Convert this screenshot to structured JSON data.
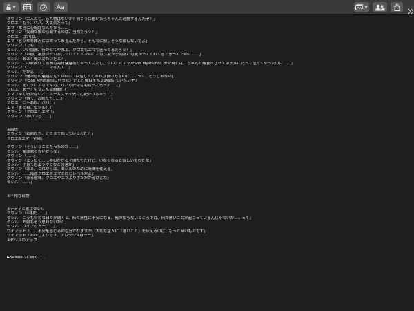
{
  "toolbar": {
    "left_icons": [
      "lock-icon",
      "sidebar-grid-icon",
      "checkmark-circle-icon"
    ],
    "format_label": "Aa",
    "right_icons": [
      "photo-gallery-icon",
      "collaborate-icon",
      "share-icon",
      "expand-icon"
    ]
  },
  "lines": [
    "ケヴィン「二人とも、忘れ物はないか？向こうに着いたらちゃんと連絡するんだぞ？」",
    "クロエ「もう、パパ。大丈夫だって」",
    "エマ「本当に心配症なんだから……」",
    "ケヴィン「父親が娘の心配するのは、当然だろう？」",
    "クロエ「はいはい」",
    "エマ「どうせ冬休みには帰って来るんだから、そんなに寂しそうな顔しないでよ」",
    "ケヴィン「でも……」",
    "セシル「いい加減、行かせてやれよ。クロエもエマも困ってるだろう？」",
    "ケヴィン「お前、案外冷たいな。クロエとエマのことは、我が子同然に可愛がってくれてると思ってたのに……」",
    "セシル「あぁ？俺が冷たいだと？」",
    "セシル「この家安けてる間も毎日連絡取り合っていたし、クロエとエマがSon Myshunoに来た時には、ちゃんと飯食べさせてホテルにだって送ってやったのに……」",
    "ケヴィン「………………今なんて？」",
    "セシル「だから……」",
    "ケヴィン「俺からの連絡なんて10回に1回返してくれれば良い方なのに……って、そうじゃない」",
    "ケヴィン「『Son Myshunoに行った』だと？俺はそんな話聞いていないぞ」",
    "セシル「え？クロエもエマも、パパの許可はもらってるって……」",
    "クロエ「あー！もうこんな時間!!」",
    "エマ「早く行かないと、ホームステイ先に心配かけちゃう！」",
    "ケヴィン「待て、お前たち……」",
    "クロエ「じゃあね、パパ！」",
    "エマ「またね、セシル！」",
    "ケヴィン「クロエ！エマ!!」",
    "ケヴィン「あいつら……」",
    "",
    "",
    "※回想",
    "ケヴィン「お前たち、どこまで知っているんだ？」",
    "クロエ&エマ「全部」",
    "",
    "ケヴィン「そういうことだったのか……」",
    "セシル「俺は悪くないからな」",
    "ケヴィン「……」",
    "ケヴィン「まったく……手のかかる子供たちだけど、いなくなると寂しいものだな」",
    "セシル「子育てもようやくひと段落か」",
    "ケヴィン「あぁ。これからは、セシルのために時間を使える」",
    "セシル「……俺はクロエやエマと同じレベルかよ」",
    "ケヴィン「ある意味、クロエやエマより手がかかるけどな」",
    "セシル「……」",
    "",
    "",
    "※平和な日常",
    "",
    "",
    "※デディと遊ぶセシル",
    "ケヴィン「平和だ……」",
    "セシル「こうも平和な日々が続くと、時々無性に不安になる。俺の知らないところでは、何か悪いことが起こっているんじゃないか……って」",
    "セシル「お前もそう思わないか？」",
    "セシル「ワイアットー……」",
    "ワイアット「……不安を感じるのも分かりますが、大切な主人に『悪いこと』を伝えるのは、もっと辛いものです」",
    "ワイアット「おかしよりです。アレクシス様ーー」",
    "※セシルのアップ",
    "",
    "",
    "",
    "►Season2に続く……"
  ]
}
